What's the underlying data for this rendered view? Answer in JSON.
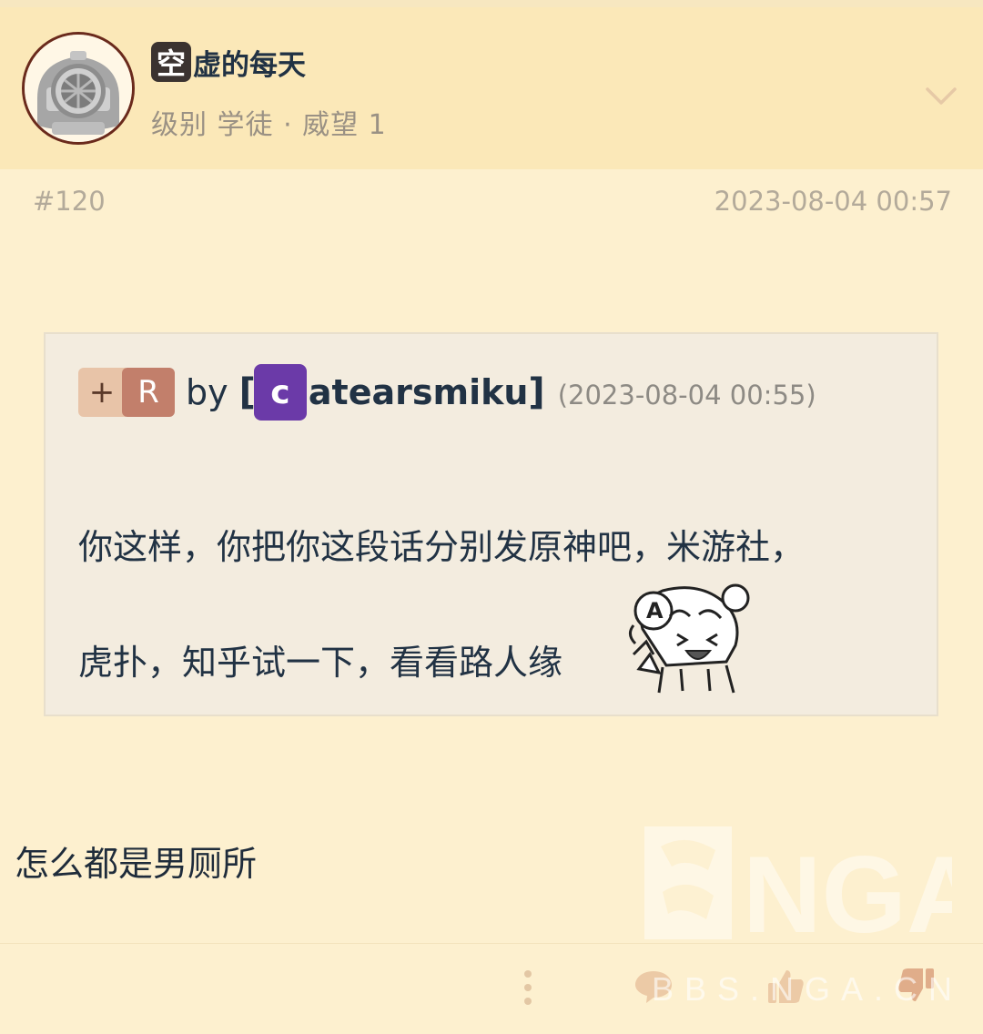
{
  "post": {
    "author": {
      "name_initial": "空",
      "name_rest": "虚的每天",
      "meta": "级别 学徒 · 威望 1"
    },
    "floor": "#120",
    "time": "2023-08-04 00:57",
    "quote": {
      "badge_plus": "+",
      "badge_r": "R",
      "by": "by",
      "bracket_open": "[",
      "user_initial": "c",
      "user_rest": "atearsmiku",
      "bracket_close": "]",
      "time": "(2023-08-04 00:55)",
      "line1": "你这样，你把你这段话分别发原神吧，米游社，",
      "line2": "虎扑，知乎试一下，看看路人缘"
    },
    "content": "怎么都是男厕所"
  },
  "watermark": {
    "logo_text": "NGA",
    "url_text": "BBS.NGA.CN"
  },
  "icons": {
    "avatar": "diving-helmet-avatar",
    "expand": "chevron-down-icon",
    "more": "more-vertical-icon",
    "comment": "comment-icon",
    "upvote": "thumbs-up-icon",
    "downvote": "thumbs-down-icon",
    "sticker": "anime-laugh-sticker"
  },
  "colors": {
    "background": "#fdf0cf",
    "header_bg": "#fbe8b8",
    "quote_bg": "#f3ecdf",
    "text": "#213244",
    "muted": "#b3aa9a",
    "badge_r": "#c27f6b",
    "user_badge": "#6b3aa8",
    "icon": "#e8c9a6"
  }
}
